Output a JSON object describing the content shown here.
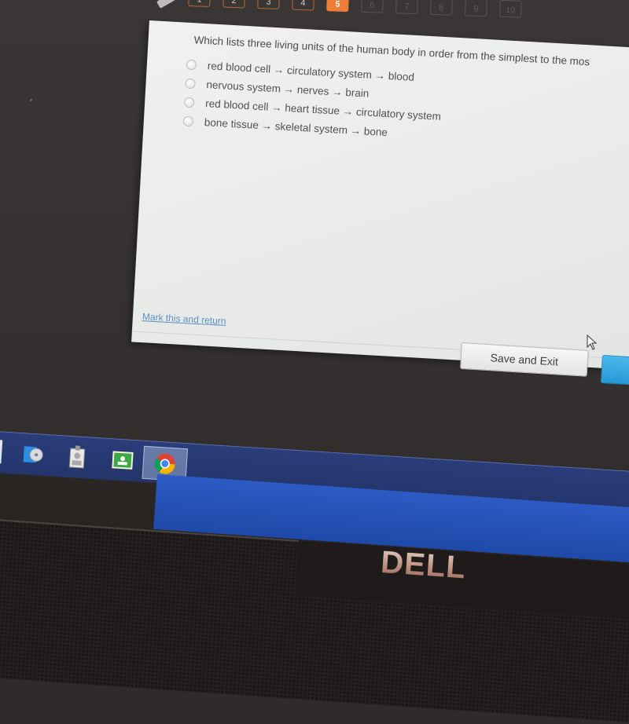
{
  "question_nav": {
    "items": [
      "1",
      "2",
      "3",
      "4",
      "5",
      "6",
      "7",
      "8",
      "9",
      "10"
    ],
    "current": "5",
    "current_color": "#ee7d35"
  },
  "tools": {
    "pencil_icon": "pencil-icon",
    "calculator_icon": "calculator-icon"
  },
  "question": {
    "prompt": "Which lists three living units of the human body in order from the simplest to the mos",
    "options": [
      {
        "label": "red blood cell → circulatory system → blood"
      },
      {
        "label": "nervous system → nerves → brain"
      },
      {
        "label": "red blood cell → heart tissue → circulatory system"
      },
      {
        "label": "bone tissue → skeletal system → bone"
      }
    ]
  },
  "footer": {
    "mark_link": "Mark this and return",
    "save_exit_label": "Save and Exit",
    "next_color": "#2ea5e0"
  },
  "taskbar": {
    "apps": [
      "media-player-icon",
      "id-badge-icon",
      "google-classroom-icon",
      "chrome-icon"
    ],
    "active": "chrome-icon"
  },
  "bezel": {
    "brand": "DELL"
  }
}
